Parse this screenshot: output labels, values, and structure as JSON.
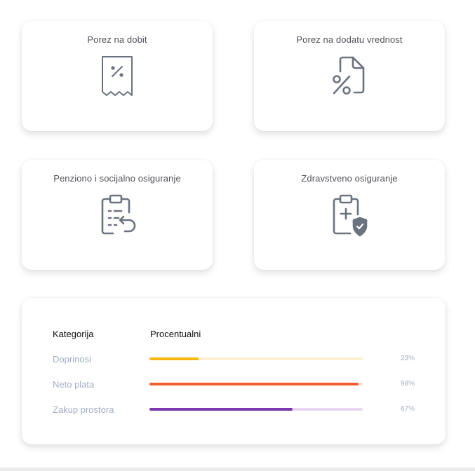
{
  "tiles": [
    {
      "title": "Porez na dobit",
      "icon": "receipt-percent-icon"
    },
    {
      "title": "Porez na dodatu vrednost",
      "icon": "document-percent-icon"
    },
    {
      "title": "Penziono i socijalno osiguranje",
      "icon": "clipboard-list-undo-icon"
    },
    {
      "title": "Zdravstveno osiguranje",
      "icon": "clipboard-plus-shield-icon"
    }
  ],
  "table": {
    "headers": {
      "category": "Kategorija",
      "percent": "Procentualni"
    },
    "rows": [
      {
        "label": "Doprinosi",
        "value": 0.23,
        "percent_label": "23%",
        "color": "#f6b70e",
        "track_color": "#fdefd1"
      },
      {
        "label": "Neto plata",
        "value": 0.98,
        "percent_label": "98%",
        "color": "#f25c31",
        "track_color": "#fde3da"
      },
      {
        "label": "Zakup prostora",
        "value": 0.67,
        "percent_label": "67%",
        "color": "#7c3aad",
        "track_color": "#e6d7f2"
      }
    ]
  }
}
